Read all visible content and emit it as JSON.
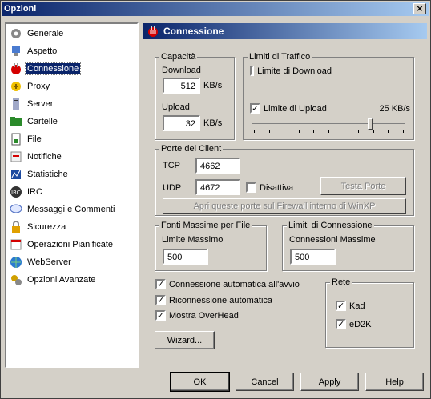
{
  "window": {
    "title": "Opzioni",
    "close_glyph": "×"
  },
  "sidebar": {
    "items": [
      {
        "label": "Generale",
        "icon": "general-icon"
      },
      {
        "label": "Aspetto",
        "icon": "appearance-icon"
      },
      {
        "label": "Connessione",
        "icon": "connection-plug-icon",
        "selected": true
      },
      {
        "label": "Proxy",
        "icon": "proxy-icon"
      },
      {
        "label": "Server",
        "icon": "server-icon"
      },
      {
        "label": "Cartelle",
        "icon": "folders-icon"
      },
      {
        "label": "File",
        "icon": "file-icon"
      },
      {
        "label": "Notifiche",
        "icon": "notifications-icon"
      },
      {
        "label": "Statistiche",
        "icon": "statistics-icon"
      },
      {
        "label": "IRC",
        "icon": "irc-icon"
      },
      {
        "label": "Messaggi e Commenti",
        "icon": "messages-icon"
      },
      {
        "label": "Sicurezza",
        "icon": "security-icon"
      },
      {
        "label": "Operazioni Pianificate",
        "icon": "scheduler-icon"
      },
      {
        "label": "WebServer",
        "icon": "webserver-icon"
      },
      {
        "label": "Opzioni Avanzate",
        "icon": "advanced-icon"
      }
    ]
  },
  "header": {
    "title": "Connessione"
  },
  "capacity": {
    "legend": "Capacità",
    "download_label": "Download",
    "download_value": "512",
    "download_unit": "KB/s",
    "upload_label": "Upload",
    "upload_value": "32",
    "upload_unit": "KB/s"
  },
  "traffic": {
    "legend": "Limiti di Traffico",
    "download_limit_label": "Limite di Download",
    "download_limit_checked": false,
    "upload_limit_label": "Limite di Upload",
    "upload_limit_checked": true,
    "upload_limit_value": "25 KB/s",
    "upload_slider_fraction": 0.78
  },
  "ports": {
    "legend": "Porte del Client",
    "tcp_label": "TCP",
    "tcp_value": "4662",
    "udp_label": "UDP",
    "udp_value": "4672",
    "disable_label": "Disattiva",
    "disable_checked": false,
    "test_button": "Testa Porte",
    "firewall_button": "Apri queste porte sul Firewall interno di WinXP"
  },
  "max_sources": {
    "legend": "Fonti Massime per File",
    "label": "Limite Massimo",
    "value": "500"
  },
  "conn_limits": {
    "legend": "Limiti di Connessione",
    "label": "Connessioni Massime",
    "value": "500"
  },
  "options": {
    "auto_connect_label": "Connessione automatica all'avvio",
    "auto_connect_checked": true,
    "reconnect_label": "Riconnessione automatica",
    "reconnect_checked": true,
    "overhead_label": "Mostra OverHead",
    "overhead_checked": true,
    "wizard_button": "Wizard..."
  },
  "network": {
    "legend": "Rete",
    "kad_label": "Kad",
    "kad_checked": true,
    "ed2k_label": "eD2K",
    "ed2k_checked": true
  },
  "footer": {
    "ok": "OK",
    "cancel": "Cancel",
    "apply": "Apply",
    "help": "Help"
  },
  "check_glyph": "✓"
}
